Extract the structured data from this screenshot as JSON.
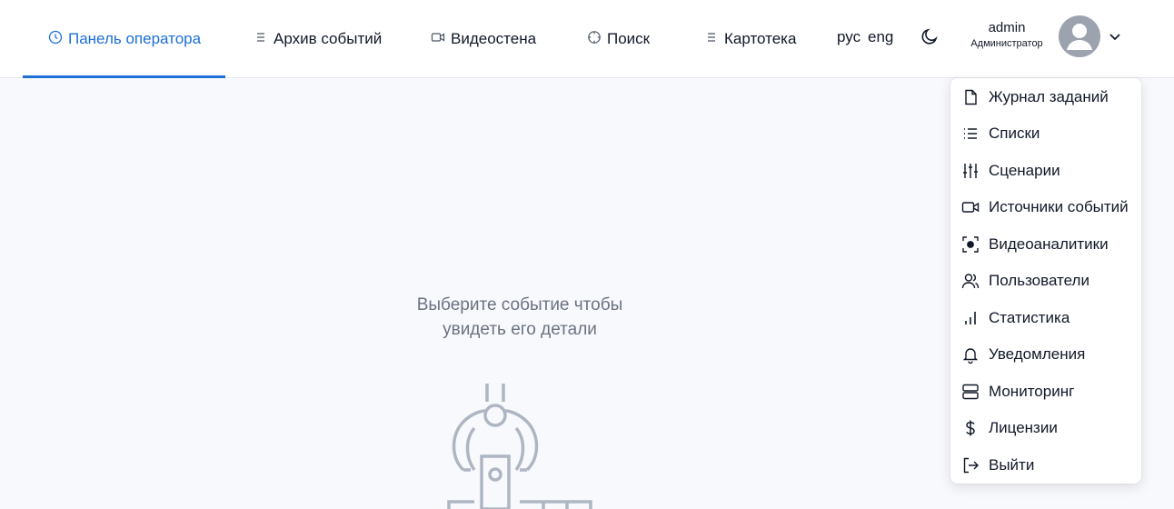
{
  "nav": {
    "tabs": [
      {
        "label": "Панель оператора",
        "icon": "clock-icon",
        "active": true
      },
      {
        "label": "Архив событий",
        "icon": "list-icon"
      },
      {
        "label": "Видеостена",
        "icon": "video-icon"
      },
      {
        "label": "Поиск",
        "icon": "target-icon"
      },
      {
        "label": "Картотека",
        "icon": "list-icon"
      }
    ],
    "languages": [
      "рус",
      "eng"
    ],
    "theme_icon": "moon-icon"
  },
  "user": {
    "name": "admin",
    "role": "Администратор",
    "avatar_icon": "user-avatar-icon",
    "menu_icon": "chevron-down-icon"
  },
  "main": {
    "empty_line1": "Выберите событие чтобы",
    "empty_line2": "увидеть его детали"
  },
  "dropdown": {
    "items": [
      {
        "label": "Журнал заданий",
        "icon": "file-icon"
      },
      {
        "label": "Списки",
        "icon": "list-icon"
      },
      {
        "label": "Сценарии",
        "icon": "sliders-icon"
      },
      {
        "label": "Источники событий",
        "icon": "video-icon"
      },
      {
        "label": "Видеоаналитики",
        "icon": "focus-icon"
      },
      {
        "label": "Пользователи",
        "icon": "users-icon"
      },
      {
        "label": "Статистика",
        "icon": "bar-chart-icon"
      },
      {
        "label": "Уведомления",
        "icon": "bell-icon"
      },
      {
        "label": "Мониторинг",
        "icon": "server-icon"
      },
      {
        "label": "Лицензии",
        "icon": "dollar-icon"
      },
      {
        "label": "Выйти",
        "icon": "logout-icon"
      }
    ]
  },
  "colors": {
    "accent": "#1d6fd8",
    "background": "#f8f9fc",
    "muted_text": "#6b7280",
    "illustration": "#aeb6c3"
  }
}
